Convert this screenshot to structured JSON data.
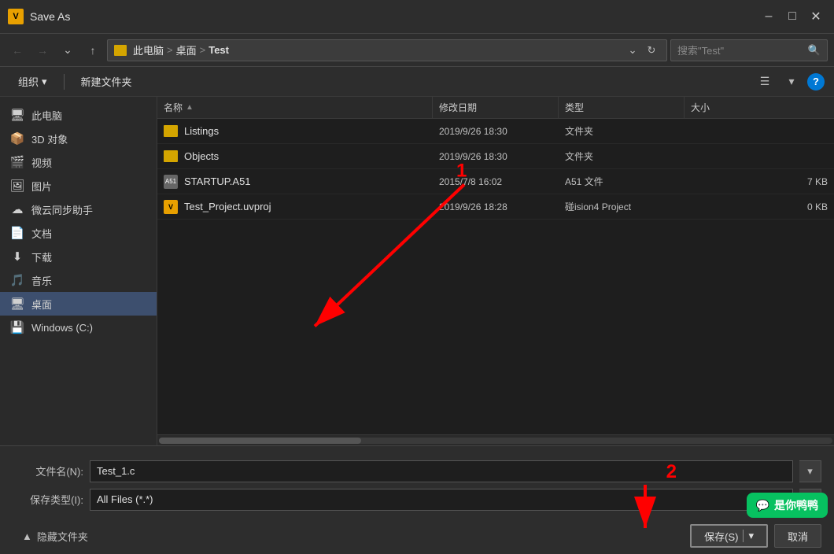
{
  "window": {
    "title": "Save As",
    "icon_label": "V"
  },
  "nav": {
    "address": {
      "parts": [
        "此电脑",
        "桌面",
        "Test"
      ],
      "search_placeholder": "搜索\"Test\""
    },
    "refresh_icon": "↻"
  },
  "toolbar": {
    "organize_label": "组织",
    "new_folder_label": "新建文件夹",
    "view_icon": "☰",
    "help_label": "?"
  },
  "sidebar": {
    "items": [
      {
        "id": "this-pc",
        "label": "此电脑",
        "icon": "🖥"
      },
      {
        "id": "3d-objects",
        "label": "3D 对象",
        "icon": "📦"
      },
      {
        "id": "video",
        "label": "视频",
        "icon": "🎬"
      },
      {
        "id": "pictures",
        "label": "图片",
        "icon": "🖼"
      },
      {
        "id": "weiyun",
        "label": "微云同步助手",
        "icon": "☁"
      },
      {
        "id": "documents",
        "label": "文档",
        "icon": "📄"
      },
      {
        "id": "downloads",
        "label": "下载",
        "icon": "⬇"
      },
      {
        "id": "music",
        "label": "音乐",
        "icon": "🎵"
      },
      {
        "id": "desktop",
        "label": "桌面",
        "icon": "🖥"
      },
      {
        "id": "windows-c",
        "label": "Windows (C:)",
        "icon": "💾"
      }
    ]
  },
  "file_list": {
    "columns": {
      "name": "名称",
      "date": "修改日期",
      "type": "类型",
      "size": "大小"
    },
    "files": [
      {
        "name": "Listings",
        "date": "2019/9/26 18:30",
        "type": "文件夹",
        "size": "",
        "kind": "folder"
      },
      {
        "name": "Objects",
        "date": "2019/9/26 18:30",
        "type": "文件夹",
        "size": "",
        "kind": "folder"
      },
      {
        "name": "STARTUP.A51",
        "date": "2015/7/8 16:02",
        "type": "A51 文件",
        "size": "7 KB",
        "kind": "a51"
      },
      {
        "name": "Test_Project.uvproj",
        "date": "2019/9/26 18:28",
        "type": "碰ision4 Project",
        "size": "0 KB",
        "kind": "v"
      }
    ]
  },
  "bottom": {
    "filename_label": "文件名(N):",
    "filename_value": "Test_1.c",
    "filetype_label": "保存类型(I):",
    "filetype_value": "All Files (*.*)"
  },
  "actions": {
    "hide_files_label": "隐藏文件夹",
    "save_label": "保存(S)",
    "cancel_label": "取消"
  },
  "annotations": {
    "label_1": "1",
    "label_2": "2"
  },
  "wechat_badge": {
    "icon": "💬",
    "text": "是你鸭鸭"
  }
}
